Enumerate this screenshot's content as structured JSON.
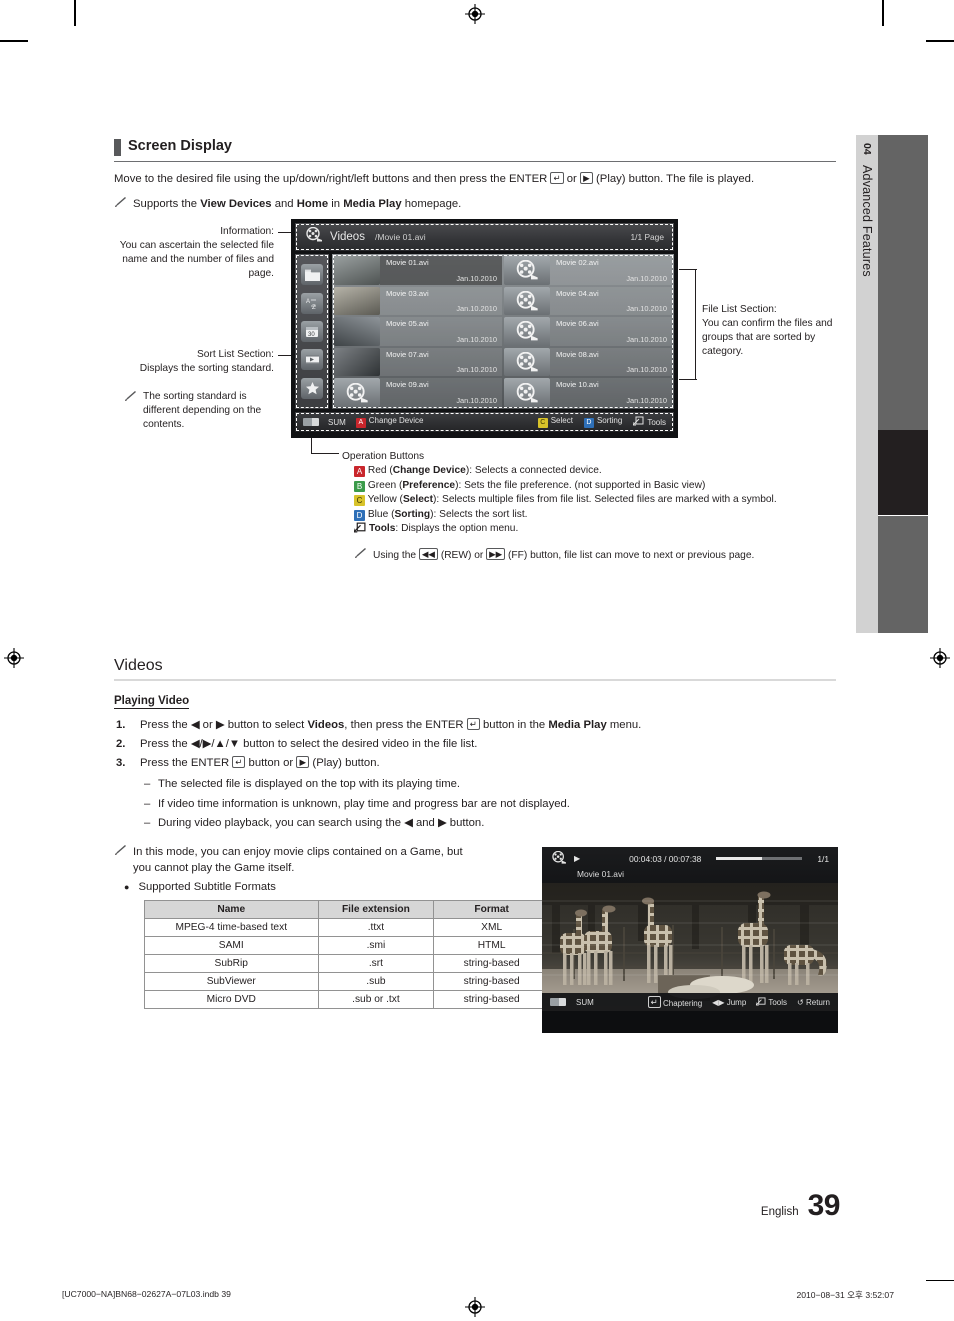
{
  "chapter_tab": {
    "number": "04",
    "label": "Advanced Features"
  },
  "screen_display": {
    "heading": "Screen Display",
    "intro_a": "Move to the desired file using the up/down/right/left buttons and then press the ENTER",
    "intro_b": "or",
    "intro_c": "(Play) button. The file is played.",
    "note_a": "Supports the",
    "note_b": "View Devices",
    "note_c": "and",
    "note_d": "Home",
    "note_e": "in",
    "note_f": "Media Play",
    "note_g": "homepage."
  },
  "callouts": {
    "information": {
      "title": "Information:",
      "body": "You can ascertain the selected file name and the number of files and page."
    },
    "sort_list": {
      "title": "Sort List Section:",
      "body": "Displays the sorting standard.",
      "note": "The sorting standard is different depending on the contents."
    },
    "file_list": {
      "title": "File List Section:",
      "body": "You can confirm the files and groups that are sorted by category."
    }
  },
  "tv_ui": {
    "title": "Videos",
    "path": "/Movie 01.avi",
    "page": "1/1 Page",
    "sort_icons": [
      "folder-icon",
      "a-z-icon",
      "calendar-30-icon",
      "filmstrip-icon",
      "star-icon"
    ],
    "files": [
      {
        "name": "Movie 01.avi",
        "date": "Jan.10.2010",
        "thumb": "photo",
        "selected": true
      },
      {
        "name": "Movie 02.avi",
        "date": "Jan.10.2010",
        "thumb": "reel",
        "selected": false
      },
      {
        "name": "Movie 03.avi",
        "date": "Jan.10.2010",
        "thumb": "photo",
        "selected": false
      },
      {
        "name": "Movie 04.avi",
        "date": "Jan.10.2010",
        "thumb": "reel",
        "selected": false
      },
      {
        "name": "Movie 05.avi",
        "date": "Jan.10.2010",
        "thumb": "photo",
        "selected": false
      },
      {
        "name": "Movie 06.avi",
        "date": "Jan.10.2010",
        "thumb": "reel",
        "selected": false
      },
      {
        "name": "Movie 07.avi",
        "date": "Jan.10.2010",
        "thumb": "photo",
        "selected": false
      },
      {
        "name": "Movie 08.avi",
        "date": "Jan.10.2010",
        "thumb": "reel",
        "selected": false
      },
      {
        "name": "Movie 09.avi",
        "date": "Jan.10.2010",
        "thumb": "reel",
        "selected": false
      },
      {
        "name": "Movie 10.avi",
        "date": "Jan.10.2010",
        "thumb": "reel",
        "selected": false
      }
    ],
    "footer": {
      "sum": "SUM",
      "a_key": "A",
      "a_label": "Change Device",
      "c_key": "C",
      "c_label": "Select",
      "d_key": "D",
      "d_label": "Sorting",
      "tools_label": "Tools"
    }
  },
  "operation_buttons": {
    "heading": "Operation Buttons",
    "items": [
      {
        "key": "A",
        "color": "#c9262c",
        "color_name": "Red",
        "bold": "Change Device",
        "text": ": Selects a connected device."
      },
      {
        "key": "B",
        "color": "#3b9b4a",
        "color_name": "Green",
        "bold": "Preference",
        "text": ": Sets the file preference. (not supported in Basic view)"
      },
      {
        "key": "C",
        "color": "#d8c32a",
        "color_name": "Yellow",
        "bold": "Select",
        "text": ": Selects multiple files from file list. Selected files are marked with a symbol."
      },
      {
        "key": "D",
        "color": "#2e6fb7",
        "color_name": "Blue",
        "bold": "Sorting",
        "text": ": Selects the sort list."
      }
    ],
    "tools_bold": "Tools",
    "tools_text": ": Displays the option menu.",
    "tip_a": "Using the",
    "tip_rew": "REW",
    "tip_b": "(REW) or",
    "tip_ff": "FF",
    "tip_c": "(FF) button, file list can move to next or previous page."
  },
  "videos": {
    "heading": "Videos",
    "subheading": "Playing Video",
    "steps": [
      {
        "a": "Press the ◀ or ▶ button to select ",
        "bold1": "Videos",
        "b": ", then press the ENTER ",
        "c": " button in the ",
        "bold2": "Media Play",
        "d": " menu."
      },
      {
        "a": "Press the ◀/▶/▲/▼ button to select the desired video in the file list."
      },
      {
        "a": "Press the ENTER ",
        "b": " button or ",
        "c": " (Play) button."
      }
    ],
    "dashes": [
      "The selected file is displayed on the top with its playing time.",
      "If video time information is unknown, play time and progress bar are not displayed.",
      "During video playback, you can search using the ◀ and ▶ button."
    ],
    "game_note": "In this mode, you can enjoy movie clips contained on a Game, but you cannot play the Game itself.",
    "subtitle_bullet": "Supported Subtitle Formats",
    "subtitle_table": {
      "headers": [
        "Name",
        "File extension",
        "Format"
      ],
      "rows": [
        [
          "MPEG-4 time-based text",
          ".ttxt",
          "XML"
        ],
        [
          "SAMI",
          ".smi",
          "HTML"
        ],
        [
          "SubRip",
          ".srt",
          "string-based"
        ],
        [
          "SubViewer",
          ".sub",
          "string-based"
        ],
        [
          "Micro DVD",
          ".sub or .txt",
          "string-based"
        ]
      ]
    }
  },
  "player": {
    "time": "00:04:03 / 00:07:38",
    "page": "1/1",
    "filename": "Movie 01.avi",
    "progress_percent": 53,
    "footer": {
      "sum": "SUM",
      "chaptering": "Chaptering",
      "jump": "Jump",
      "tools": "Tools",
      "return": "Return"
    }
  },
  "footer": {
    "language": "English",
    "page_number": "39",
    "file_ref": "[UC7000−NA]BN68−02627A−07L03.indb   39",
    "timestamp": "2010−08−31   오후 3:52:07"
  }
}
